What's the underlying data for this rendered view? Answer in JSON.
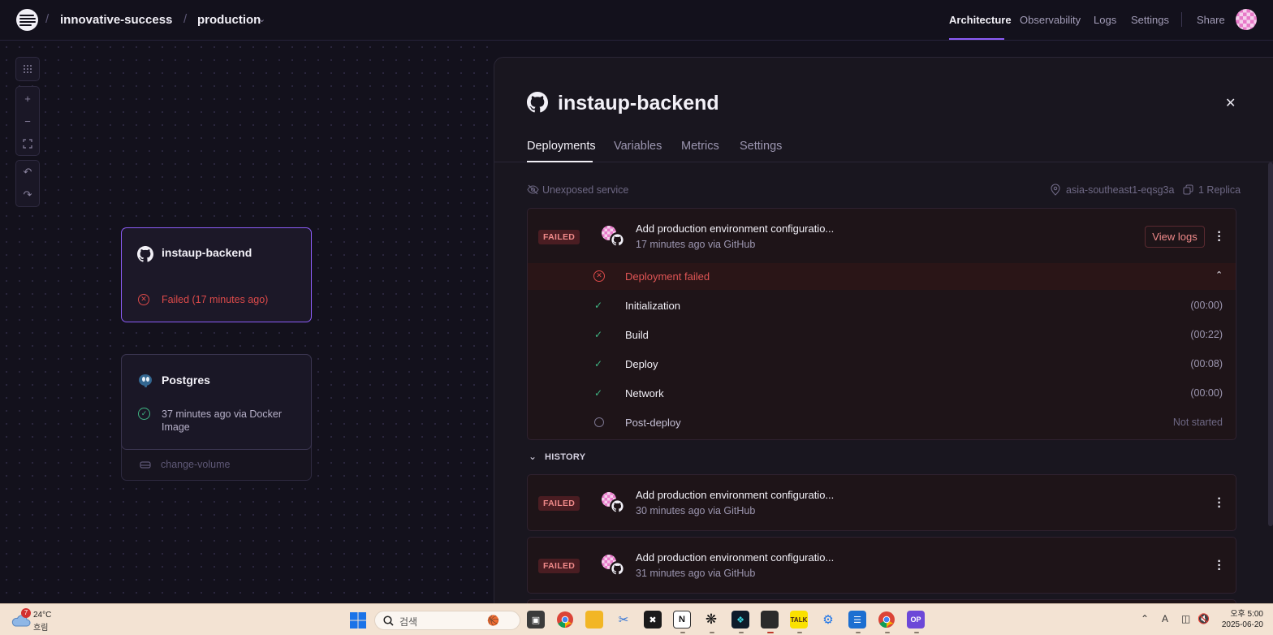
{
  "nav": {
    "project": "innovative-success",
    "environment": "production",
    "links": [
      "Architecture",
      "Observability",
      "Logs",
      "Settings"
    ],
    "share": "Share"
  },
  "canvas": {
    "cards": {
      "backend": {
        "title": "instaup-backend",
        "status": "Failed (17 minutes ago)"
      },
      "postgres": {
        "title": "Postgres",
        "status": "37 minutes ago via Docker Image",
        "volume": "change-volume"
      }
    }
  },
  "panel": {
    "title": "instaup-backend",
    "tabs": [
      "Deployments",
      "Variables",
      "Metrics",
      "Settings"
    ],
    "exposure": "Unexposed service",
    "region": "asia-southeast1-eqsg3a",
    "replicas": "1 Replica",
    "active_deployment": {
      "badge": "FAILED",
      "message": "Add production environment configuratio...",
      "meta": "17 minutes ago via GitHub",
      "view_logs": "View logs",
      "failed_label": "Deployment failed",
      "steps": [
        {
          "name": "Initialization",
          "time": "(00:00)",
          "state": "done"
        },
        {
          "name": "Build",
          "time": "(00:22)",
          "state": "done"
        },
        {
          "name": "Deploy",
          "time": "(00:08)",
          "state": "done"
        },
        {
          "name": "Network",
          "time": "(00:00)",
          "state": "done"
        },
        {
          "name": "Post-deploy",
          "time": "Not started",
          "state": "pending"
        }
      ]
    },
    "history_label": "HISTORY",
    "history": [
      {
        "badge": "FAILED",
        "message": "Add production environment configuratio...",
        "meta": "30 minutes ago via GitHub"
      },
      {
        "badge": "FAILED",
        "message": "Add production environment configuratio...",
        "meta": "31 minutes ago via GitHub"
      }
    ]
  },
  "taskbar": {
    "weather_temp": "24°C",
    "weather_desc": "흐림",
    "weather_badge": "7",
    "search_placeholder": "검색",
    "clock_time": "오후 5:00",
    "clock_date": "2025-06-20",
    "ime": "A"
  },
  "colors": {
    "accent": "#8b5cf6",
    "failed": "#dc4a4a",
    "success": "#3fb784"
  }
}
